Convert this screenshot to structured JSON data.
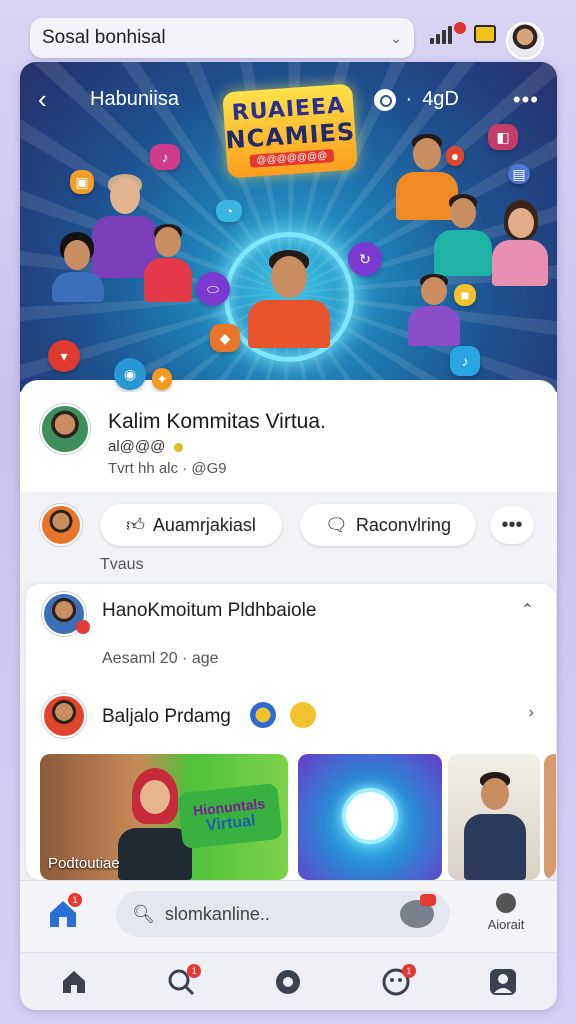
{
  "browser": {
    "site_title": "Sosal bonhisal",
    "chevron_icon": "chevron-down-icon"
  },
  "hero": {
    "title": "Habuniisa",
    "count": "4gD",
    "logo_line1": "RUAIEEA",
    "logo_line2": "NCAMIES",
    "logo_banner": "@@@@@@@",
    "background_color": "#1f6fae",
    "accent": "#7ee7ff"
  },
  "profile": {
    "name": "Kalim Kommitas Virtua.",
    "subtitle": "al@@@",
    "meta": "Tvrt hh alc · @G9"
  },
  "actions": {
    "primary_label": "Auamrjakiasl",
    "secondary_label": "Raconvlring",
    "tab_label": "Tvaus"
  },
  "feed": {
    "post1_name": "HanoKmoitum Pldhbaiole",
    "post1_time": "Aesaml 20 · age",
    "post2_name": "Baljalo Prdamg",
    "thumb1_caption": "Podtoutiae",
    "thumb1_sign_line1": "Hionuntals",
    "thumb1_sign_line2": "Virtual"
  },
  "bottom": {
    "search_placeholder": "slomkanline..",
    "account_label": "Aiorait"
  },
  "badges": {
    "home_badge": "1",
    "nav_search_badge": "1",
    "nav_emoji_badge": "1"
  }
}
